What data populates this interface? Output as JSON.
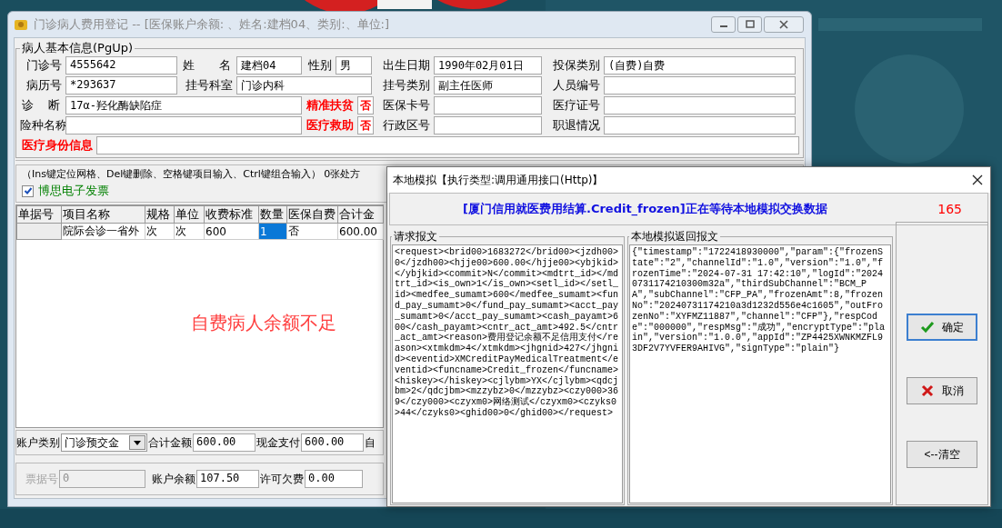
{
  "main_window": {
    "title": "门诊病人费用登记 -- [医保账户余额: 、姓名:建档04、类别:、单位:]"
  },
  "patient_info": {
    "title": "病人基本信息(PgUp)",
    "fields": [
      {
        "kind": "text",
        "label": "门诊号",
        "value": "4555642"
      },
      {
        "kind": "text",
        "label": "姓 名",
        "value": "建档04"
      },
      {
        "kind": "text",
        "label": "性别",
        "value": "男"
      },
      {
        "kind": "text",
        "label": "出生日期",
        "value": "1990年02月01日"
      },
      {
        "kind": "text",
        "label": "投保类别",
        "value": "(自费)自费"
      },
      {
        "kind": "text",
        "label": "病历号",
        "value": "*293637"
      },
      {
        "kind": "text",
        "label": "挂号科室",
        "value": "门诊内科"
      },
      {
        "kind": "text",
        "label": "挂号类别",
        "value": "副主任医师"
      },
      {
        "kind": "text",
        "label": "人员编号"
      },
      {
        "kind": "text",
        "label": "诊 断",
        "value": "17α-羟化酶缺陷症"
      },
      {
        "kind": "flag",
        "label": "精准扶贫",
        "color": "#ff0000",
        "value": "否"
      },
      {
        "kind": "text",
        "label": "医保卡号"
      },
      {
        "kind": "text",
        "label": "医疗证号"
      },
      {
        "kind": "text",
        "label": "险种名称"
      },
      {
        "kind": "flag",
        "label": "医疗救助",
        "color": "#ff0000",
        "value": "否"
      },
      {
        "kind": "text",
        "label": "行政区号"
      },
      {
        "kind": "text",
        "label": "职退情况"
      }
    ],
    "identity": {
      "label": "医疗身份信息",
      "color": "#ff0000"
    }
  },
  "hint": "（Ins键定位网格、Del键删除、空格键项目输入、Ctrl键组合输入） 0张处方",
  "e_invoice": {
    "label": "博思电子发票",
    "checked": true
  },
  "items_table": {
    "columns": [
      "单据号",
      "项目名称",
      "规格",
      "单位",
      "收费标准",
      "数量",
      "医保自费",
      "合计金"
    ],
    "rows": [
      {
        "cells": [
          {
            "selected": false
          },
          {
            "text": "院际会诊一省外",
            "selected": false
          },
          {
            "text": "次",
            "selected": false
          },
          {
            "text": "次",
            "selected": false
          },
          {
            "text": "600",
            "selected": false
          },
          {
            "text": "1",
            "selected": true
          },
          {
            "text": "否",
            "selected": false
          },
          {
            "text": "600.00",
            "selected": false
          }
        ]
      }
    ],
    "message": "自费病人余额不足"
  },
  "account": {
    "type_label": "账户类别",
    "type_value": "门诊预交金",
    "total_label": "合计金额",
    "total_value": "600.00",
    "cash_label": "现金支付",
    "cash_value": "600.00",
    "cut_label": "自"
  },
  "ticket": {
    "number_label": "票据号",
    "number_value": "0",
    "disabled": true,
    "balance_label": "账户余额",
    "balance_value": "107.50",
    "credit_label": "许可欠费",
    "credit_value": "0.00"
  },
  "dialog": {
    "title": "本地模拟【执行类型:调用通用接口(Http)】",
    "banner": "[厦门信用就医费用结算.Credit_frozen]正在等待本地模拟交换数据",
    "counter": "165",
    "request": {
      "title": "请求报文",
      "text": "<request><brid00>1683272</brid00><jzdh00>0</jzdh00><hjje00>600.00</hjje00><ybjkid></ybjkid><commit>N</commit><mdtrt_id></mdtrt_id><is_own>1</is_own><setl_id></setl_id><medfee_sumamt>600</medfee_sumamt><fund_pay_sumamt>0</fund_pay_sumamt><acct_pay_sumamt>0</acct_pay_sumamt><cash_payamt>600</cash_payamt><cntr_act_amt>492.5</cntr_act_amt><reason>费用登记余额不足信用支付</reason><xtmkdm>4</xtmkdm><jhgnid>427</jhgnid><eventid>XMCreditPayMedicalTreatment</eventid><funcname>Credit_frozen</funcname><hiskey></hiskey><cjlybm>YX</cjlybm><qdcjbm>2</qdcjbm><mzzybz>0</mzzybz><czy000>369</czy000><czyxm0>网络测试</czyxm0><czyks0>44</czyks0><ghid00>0</ghid00></request>"
    },
    "response": {
      "title": "本地模拟返回报文",
      "text": "{\"timestamp\":\"1722418930000\",\"param\":{\"frozenState\":\"2\",\"channelId\":\"1.0\",\"version\":\"1.0\",\"frozenTime\":\"2024-07-31 17:42:10\",\"logId\":\"20240731174210300m32a\",\"thirdSubChannel\":\"BCM_PA\",\"subChannel\":\"CFP_PA\",\"frozenAmt\":8,\"frozenNo\":\"20240731174210a3d1232d556e4c1605\",\"outFrozenNo\":\"XYFMZ11887\",\"channel\":\"CFP\"},\"respCode\":\"000000\",\"respMsg\":\"成功\",\"encryptType\":\"plain\",\"version\":\"1.0.0\",\"appId\":\"ZP4425XWNKMZFL93DF2V7YVFER9AHIVG\",\"signType\":\"plain\"}"
    },
    "buttons": [
      {
        "kind": "ok",
        "label": "确定"
      },
      {
        "kind": "cancel",
        "label": "取消"
      },
      {
        "kind": "clear",
        "label": "<--清空"
      }
    ]
  }
}
